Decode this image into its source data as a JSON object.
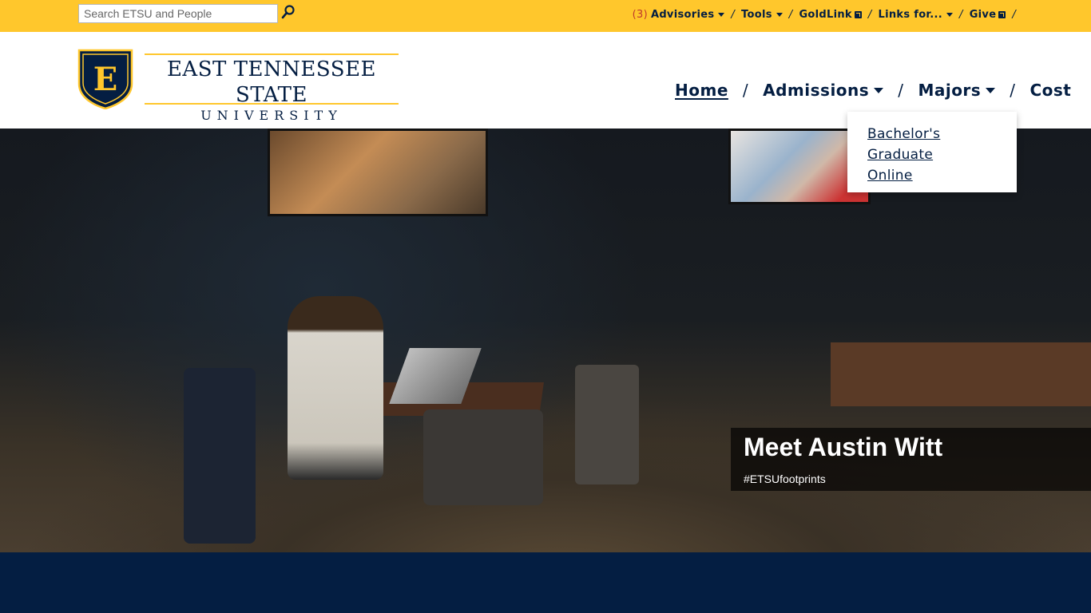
{
  "search": {
    "placeholder": "Search ETSU and People"
  },
  "utility_nav": {
    "advisories_count": "(3)",
    "advisories": "Advisories",
    "tools": "Tools",
    "goldlink": "GoldLink",
    "links_for": "Links for...",
    "give": "Give",
    "separator": "/"
  },
  "logo": {
    "line1": "EAST TENNESSEE STATE",
    "line2": "UNIVERSITY"
  },
  "main_nav": {
    "home": "Home",
    "admissions": "Admissions",
    "majors": "Majors",
    "cost": "Cost",
    "separator": "/"
  },
  "majors_dropdown": {
    "items": [
      "Bachelor's",
      "Graduate",
      "Online"
    ]
  },
  "hero": {
    "title": "Meet Austin Witt",
    "hashtag": "#ETSUfootprints"
  },
  "colors": {
    "gold": "#ffc72c",
    "navy": "#041e42",
    "advisory_count": "#c0392b"
  },
  "icons": {
    "search": "search-icon",
    "dropdown": "chevron-down-icon",
    "external": "external-link-icon"
  }
}
